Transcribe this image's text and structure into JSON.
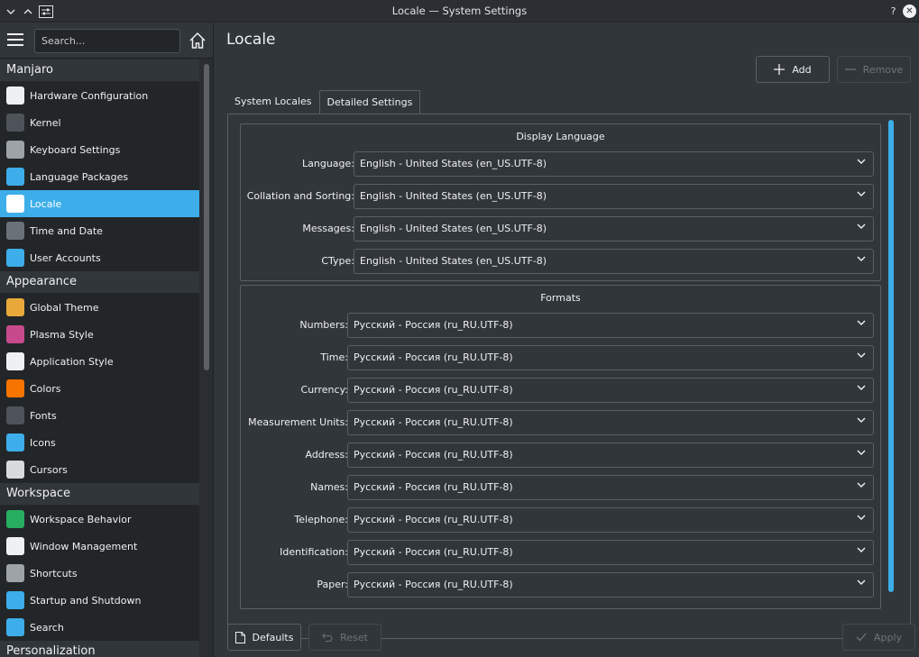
{
  "window": {
    "title": "Locale — System Settings",
    "help_glyph": "?",
    "close_glyph": "✕"
  },
  "sidebar": {
    "search_placeholder": "Search...",
    "groups": [
      {
        "header": "Manjaro",
        "items": [
          {
            "label": "Hardware Configuration",
            "icon": "hardware-icon",
            "color": "#eff0f1"
          },
          {
            "label": "Kernel",
            "icon": "kernel-icon",
            "color": "#4d5359"
          },
          {
            "label": "Keyboard Settings",
            "icon": "keyboard-icon",
            "color": "#9ea3a8"
          },
          {
            "label": "Language Packages",
            "icon": "language-packages-icon",
            "color": "#3daee9"
          },
          {
            "label": "Locale",
            "icon": "locale-icon",
            "color": "#ffffff",
            "active": true
          },
          {
            "label": "Time and Date",
            "icon": "clock-icon",
            "color": "#6b7178"
          },
          {
            "label": "User Accounts",
            "icon": "user-icon",
            "color": "#3daee9"
          }
        ]
      },
      {
        "header": "Appearance",
        "items": [
          {
            "label": "Global Theme",
            "icon": "global-theme-icon",
            "color": "#e8a83a"
          },
          {
            "label": "Plasma Style",
            "icon": "plasma-style-icon",
            "color": "#c74a8d"
          },
          {
            "label": "Application Style",
            "icon": "application-style-icon",
            "color": "#eff0f1"
          },
          {
            "label": "Colors",
            "icon": "colors-icon",
            "color": "#f67400"
          },
          {
            "label": "Fonts",
            "icon": "fonts-icon",
            "color": "#4d5359"
          },
          {
            "label": "Icons",
            "icon": "icons-icon",
            "color": "#3daee9"
          },
          {
            "label": "Cursors",
            "icon": "cursors-icon",
            "color": "#d8dadc"
          }
        ]
      },
      {
        "header": "Workspace",
        "items": [
          {
            "label": "Workspace Behavior",
            "icon": "workspace-behavior-icon",
            "color": "#27ae60"
          },
          {
            "label": "Window Management",
            "icon": "window-management-icon",
            "color": "#eff0f1"
          },
          {
            "label": "Shortcuts",
            "icon": "shortcuts-icon",
            "color": "#9ea3a8"
          },
          {
            "label": "Startup and Shutdown",
            "icon": "startup-shutdown-icon",
            "color": "#3daee9"
          },
          {
            "label": "Search",
            "icon": "search-icon",
            "color": "#3daee9"
          }
        ]
      },
      {
        "header": "Personalization",
        "items": []
      }
    ]
  },
  "main": {
    "title": "Locale",
    "add_label": "Add",
    "remove_label": "Remove",
    "tabs": [
      "System Locales",
      "Detailed Settings"
    ],
    "display_language": {
      "title": "Display Language",
      "rows": [
        {
          "label": "Language:",
          "value": "English - United States (en_US.UTF-8)"
        },
        {
          "label": "Collation and Sorting:",
          "value": "English - United States (en_US.UTF-8)"
        },
        {
          "label": "Messages:",
          "value": "English - United States (en_US.UTF-8)"
        },
        {
          "label": "CType:",
          "value": "English - United States (en_US.UTF-8)"
        }
      ]
    },
    "formats": {
      "title": "Formats",
      "rows": [
        {
          "label": "Numbers:",
          "value": "Русский - Россия (ru_RU.UTF-8)"
        },
        {
          "label": "Time:",
          "value": "Русский - Россия (ru_RU.UTF-8)"
        },
        {
          "label": "Currency:",
          "value": "Русский - Россия (ru_RU.UTF-8)"
        },
        {
          "label": "Measurement Units:",
          "value": "Русский - Россия (ru_RU.UTF-8)"
        },
        {
          "label": "Address:",
          "value": "Русский - Россия (ru_RU.UTF-8)"
        },
        {
          "label": "Names:",
          "value": "Русский - Россия (ru_RU.UTF-8)"
        },
        {
          "label": "Telephone:",
          "value": "Русский - Россия (ru_RU.UTF-8)"
        },
        {
          "label": "Identification:",
          "value": "Русский - Россия (ru_RU.UTF-8)"
        },
        {
          "label": "Paper:",
          "value": "Русский - Россия (ru_RU.UTF-8)"
        }
      ]
    },
    "defaults_label": "Defaults",
    "reset_label": "Reset",
    "apply_label": "Apply"
  },
  "colors": {
    "accent": "#3daee9",
    "background": "#31363b",
    "sidebar_item_bg": "#232629"
  }
}
